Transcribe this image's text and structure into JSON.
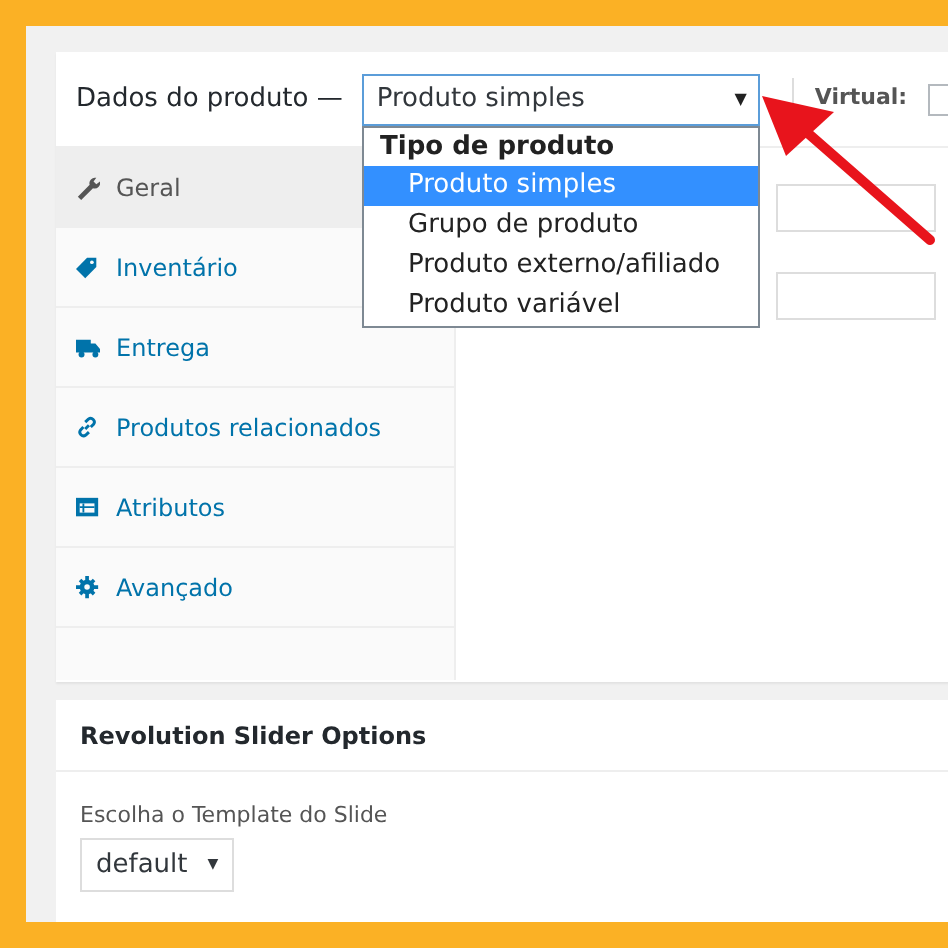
{
  "product_data": {
    "title": "Dados do produto —",
    "type_select": {
      "value": "Produto simples",
      "caret": "▼",
      "expanded": true
    },
    "dropdown": {
      "group_label": "Tipo de produto",
      "options": [
        {
          "label": "Produto simples",
          "selected": true
        },
        {
          "label": "Grupo de produto",
          "selected": false
        },
        {
          "label": "Produto externo/afiliado",
          "selected": false
        },
        {
          "label": "Produto variável",
          "selected": false
        }
      ]
    },
    "virtual": {
      "label": "Virtual:",
      "checked": false
    },
    "tabs": [
      {
        "label": "Geral",
        "kind": "wrench",
        "selected": true
      },
      {
        "label": "Inventário",
        "kind": "tag",
        "selected": false
      },
      {
        "label": "Entrega",
        "kind": "truck",
        "selected": false
      },
      {
        "label": "Produtos relacionados",
        "kind": "link",
        "selected": false
      },
      {
        "label": "Atributos",
        "kind": "table",
        "selected": false
      },
      {
        "label": "Avançado",
        "kind": "gear",
        "selected": false
      }
    ]
  },
  "slider_options": {
    "title": "Revolution Slider Options",
    "field_label": "Escolha o Template do Slide",
    "select": {
      "value": "default",
      "caret": "▼"
    }
  }
}
